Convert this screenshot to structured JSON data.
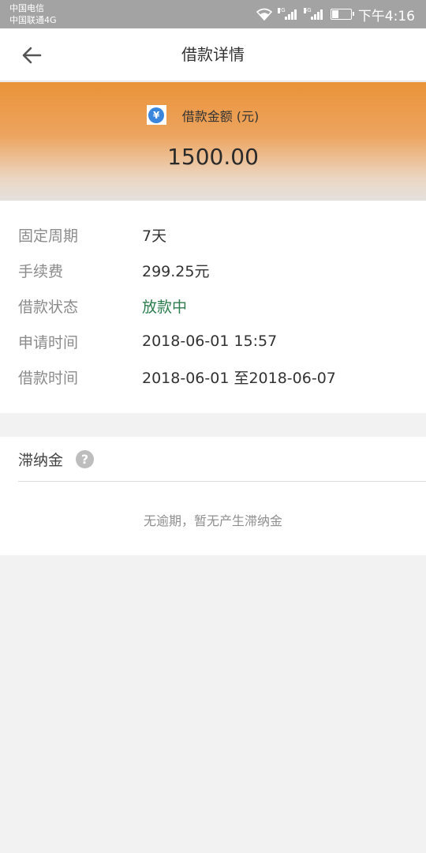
{
  "status_bar": {
    "carrier_primary": "中国电信",
    "carrier_secondary": "中国联通4G",
    "signal_1_tag": "2G",
    "signal_2_tag": "4G",
    "battery_level": 0.35,
    "time": "下午4:16"
  },
  "nav": {
    "back_icon": "arrow-left-icon",
    "title": "借款详情"
  },
  "amount": {
    "icon": "yen-icon",
    "icon_glyph": "¥",
    "label": "借款金额 (元)",
    "value": "1500.00",
    "colors": {
      "banner_top": "#ea9338",
      "banner_bottom": "#e4e0dd",
      "icon_blue": "#3a86dc"
    }
  },
  "details": {
    "rows": [
      {
        "label": "固定周期",
        "value": "7天"
      },
      {
        "label": "手续费",
        "value": "299.25元"
      },
      {
        "label": "借款状态",
        "value": "放款中",
        "status_color": "#2e7d4f"
      },
      {
        "label": "申请时间",
        "value": "2018-06-01 15:57"
      },
      {
        "label": "借款时间",
        "value": "2018-06-01 至2018-06-07"
      }
    ]
  },
  "late_fee": {
    "title": "滞纳金",
    "help_icon": "question-mark-icon",
    "help_glyph": "?",
    "note": "无逾期，暂无产生滞纳金"
  }
}
